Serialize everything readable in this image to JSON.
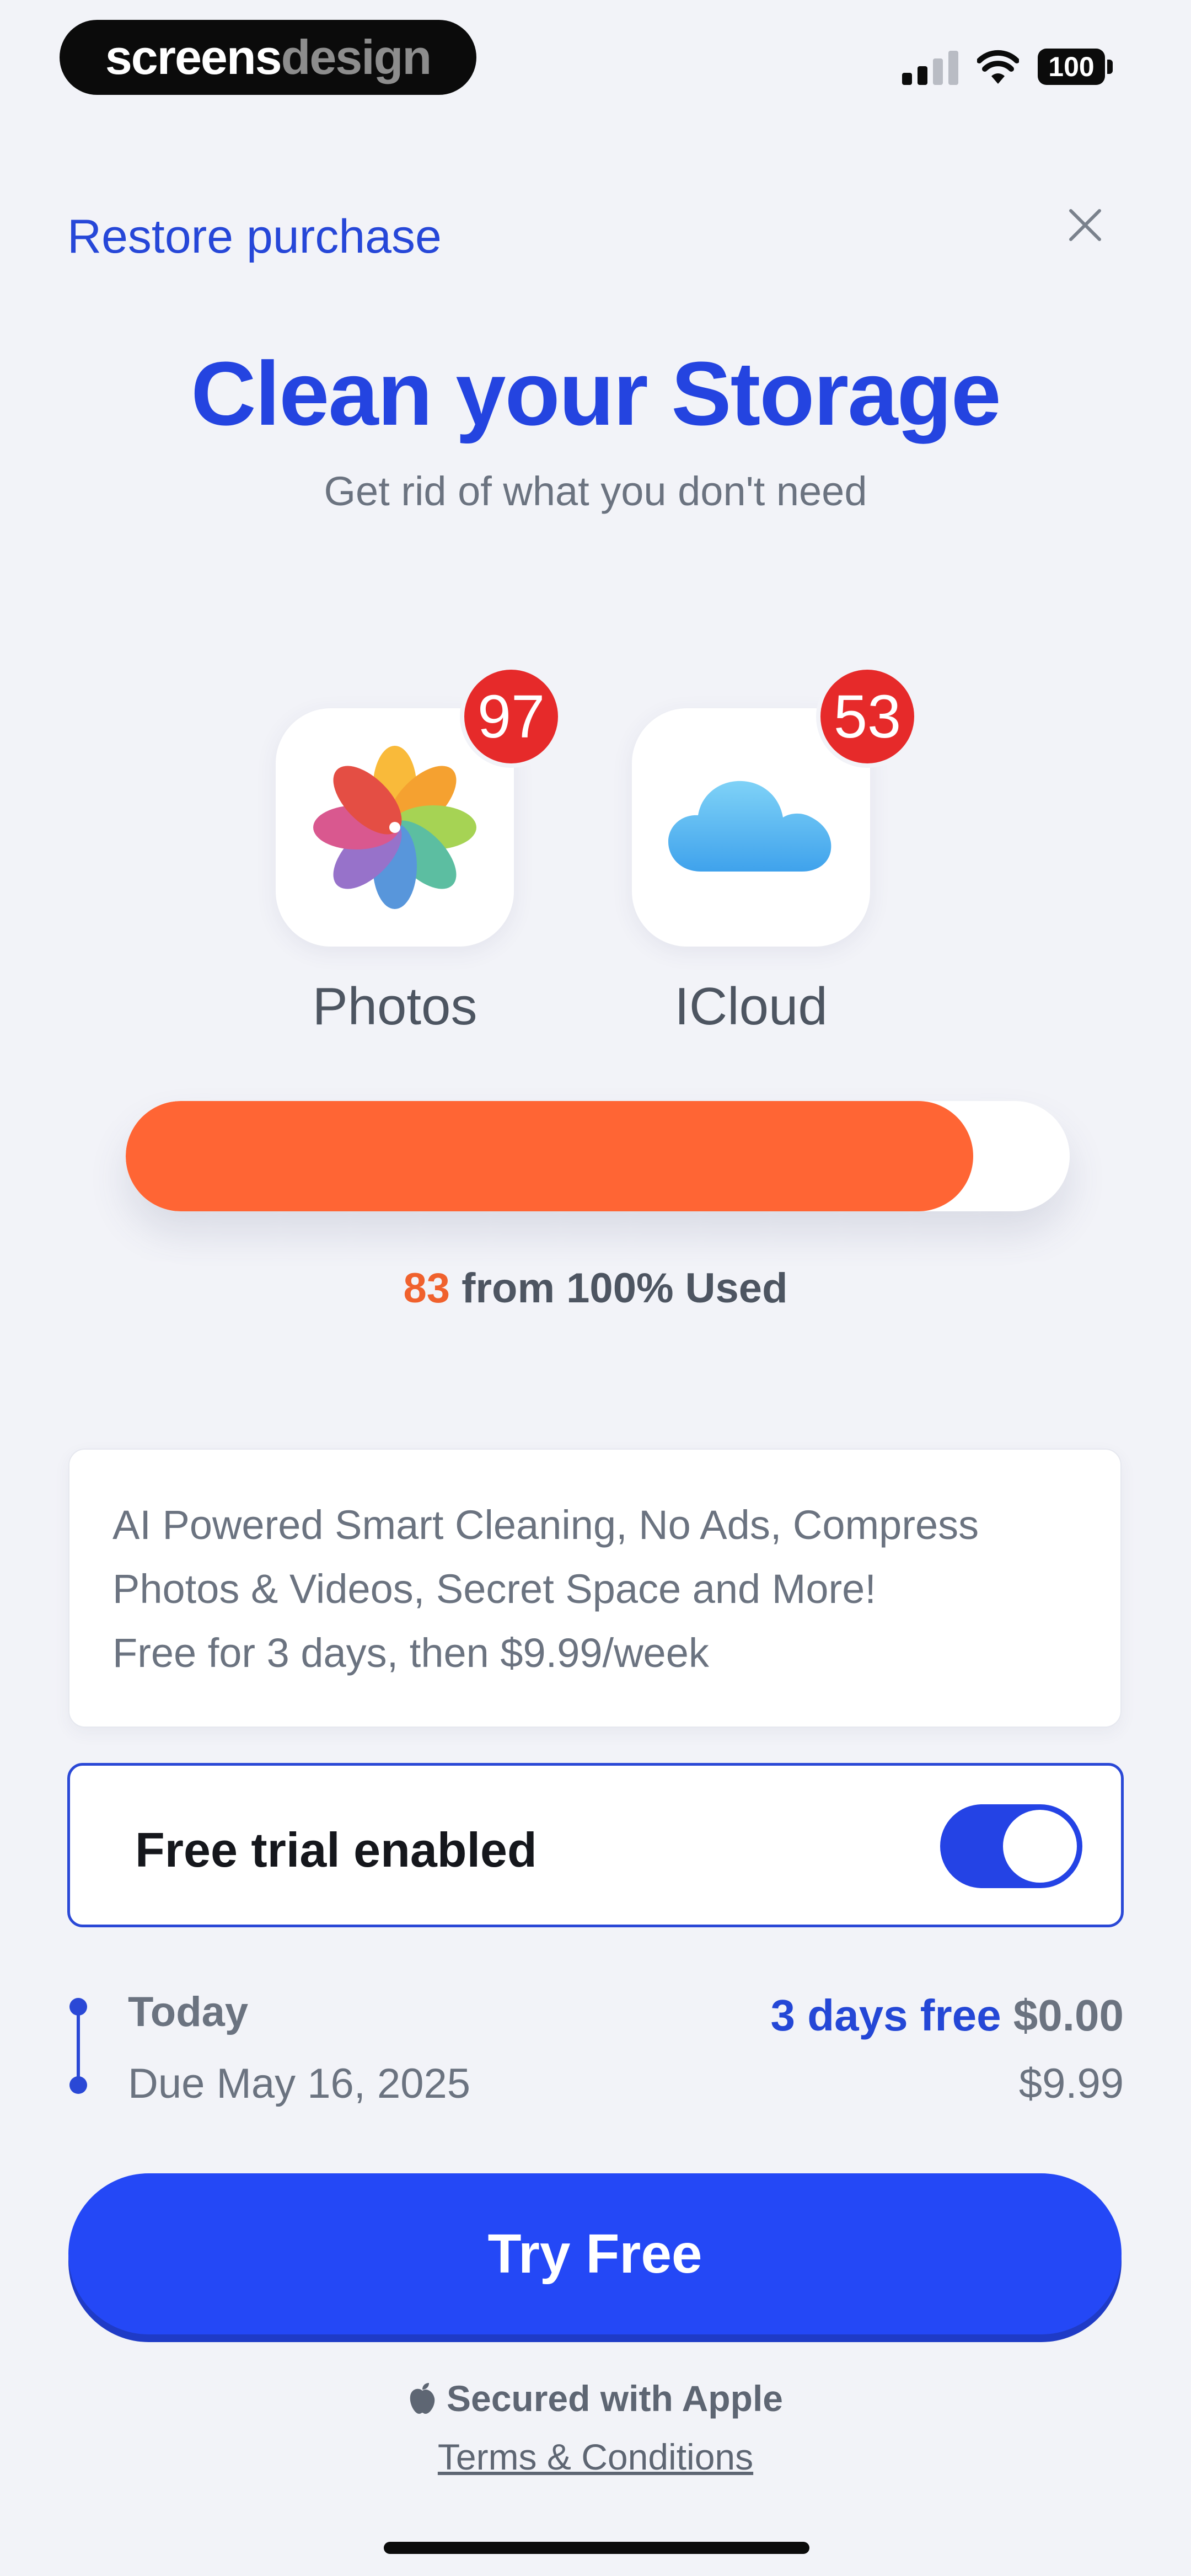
{
  "status_bar": {
    "watermark_part1": "screens",
    "watermark_part2": "design",
    "battery": "100",
    "signal_icon": "cellular-signal-icon",
    "wifi_icon": "wifi-icon"
  },
  "header": {
    "restore_label": "Restore purchase",
    "close_icon": "close-icon"
  },
  "hero": {
    "title": "Clean your Storage",
    "subtitle": "Get rid of what you don't need"
  },
  "apps": [
    {
      "label": "Photos",
      "badge": "97",
      "icon": "photos-app-icon"
    },
    {
      "label": "ICloud",
      "badge": "53",
      "icon": "icloud-app-icon"
    }
  ],
  "storage": {
    "used_percent": 83,
    "used_value": "83",
    "used_suffix": " from 100% Used",
    "fill_color": "#ff6534"
  },
  "features": {
    "line1": "AI Powered Smart Cleaning, No Ads, Compress",
    "line2": "Photos & Videos, Secret Space and More!",
    "line3": "Free for 3 days, then $9.99/week"
  },
  "trial": {
    "label": "Free trial enabled",
    "enabled": true
  },
  "timeline": {
    "today_label": "Today",
    "today_free": "3 days free",
    "today_price": "$0.00",
    "due_label": "Due May 16, 2025",
    "due_price": "$9.99"
  },
  "cta": {
    "label": "Try Free",
    "secured_label": "Secured with Apple",
    "terms_label": "Terms & Conditions"
  },
  "colors": {
    "accent": "#2448f6",
    "title": "#2444e0",
    "badge": "#e62a2a",
    "usage": "#ff6534"
  }
}
